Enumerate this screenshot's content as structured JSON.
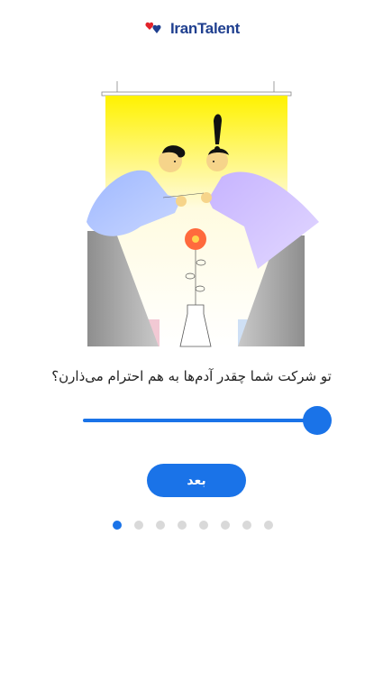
{
  "brand": {
    "logo_text": "IranTalent",
    "colors": {
      "red": "#e2232a",
      "blue": "#1f3f8f"
    }
  },
  "illustration": {
    "subject": "two-people-bowing-with-flower-icon"
  },
  "question": {
    "text": "تو شرکت شما چقدر آدم‌ها به هم احترام می‌ذارن؟"
  },
  "slider": {
    "value": 1.0,
    "color": "#1a73e8"
  },
  "next_button": {
    "label": "بعد"
  },
  "pagination": {
    "total": 8,
    "current": 1,
    "active_color": "#1a73e8",
    "inactive_color": "#d9d9d9"
  }
}
